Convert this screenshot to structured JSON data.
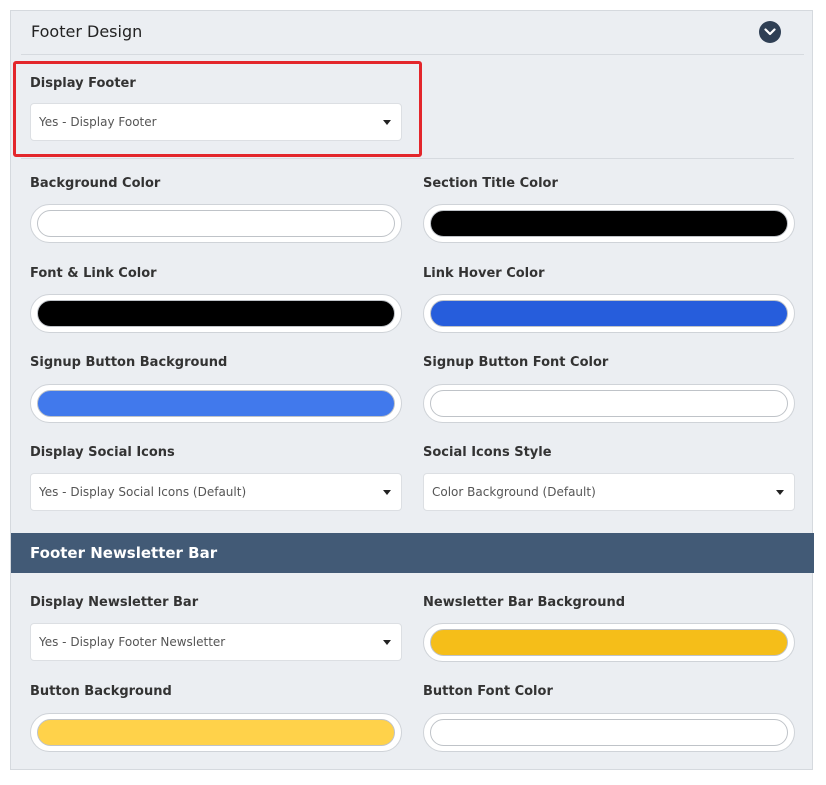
{
  "footer_design": {
    "title": "Footer Design",
    "display_footer": {
      "label": "Display Footer",
      "value": "Yes - Display Footer"
    },
    "background_color": {
      "label": "Background Color",
      "color": "#ffffff"
    },
    "section_title_color": {
      "label": "Section Title Color",
      "color": "#000000"
    },
    "font_link_color": {
      "label": "Font & Link Color",
      "color": "#000000"
    },
    "link_hover_color": {
      "label": "Link Hover Color",
      "color": "#265ddc"
    },
    "signup_button_background": {
      "label": "Signup Button Background",
      "color": "#4179ec"
    },
    "signup_button_font_color": {
      "label": "Signup Button Font Color",
      "color": "#ffffff"
    },
    "display_social_icons": {
      "label": "Display Social Icons",
      "value": "Yes - Display Social Icons (Default)"
    },
    "social_icons_style": {
      "label": "Social Icons Style",
      "value": "Color Background (Default)"
    }
  },
  "newsletter_bar": {
    "title": "Footer Newsletter Bar",
    "display_newsletter_bar": {
      "label": "Display Newsletter Bar",
      "value": "Yes - Display Footer Newsletter"
    },
    "newsletter_bar_background": {
      "label": "Newsletter Bar Background",
      "color": "#f5be19"
    },
    "button_background": {
      "label": "Button Background",
      "color": "#ffd24a"
    },
    "button_font_color": {
      "label": "Button Font Color",
      "color": "#ffffff"
    }
  },
  "icons": {
    "collapse": "chevron-down-icon",
    "select_caret": "caret-down-icon"
  },
  "colors": {
    "section_bar": "#425a76",
    "highlight": "#e3262b",
    "collapse_button": "#2f3f54"
  }
}
